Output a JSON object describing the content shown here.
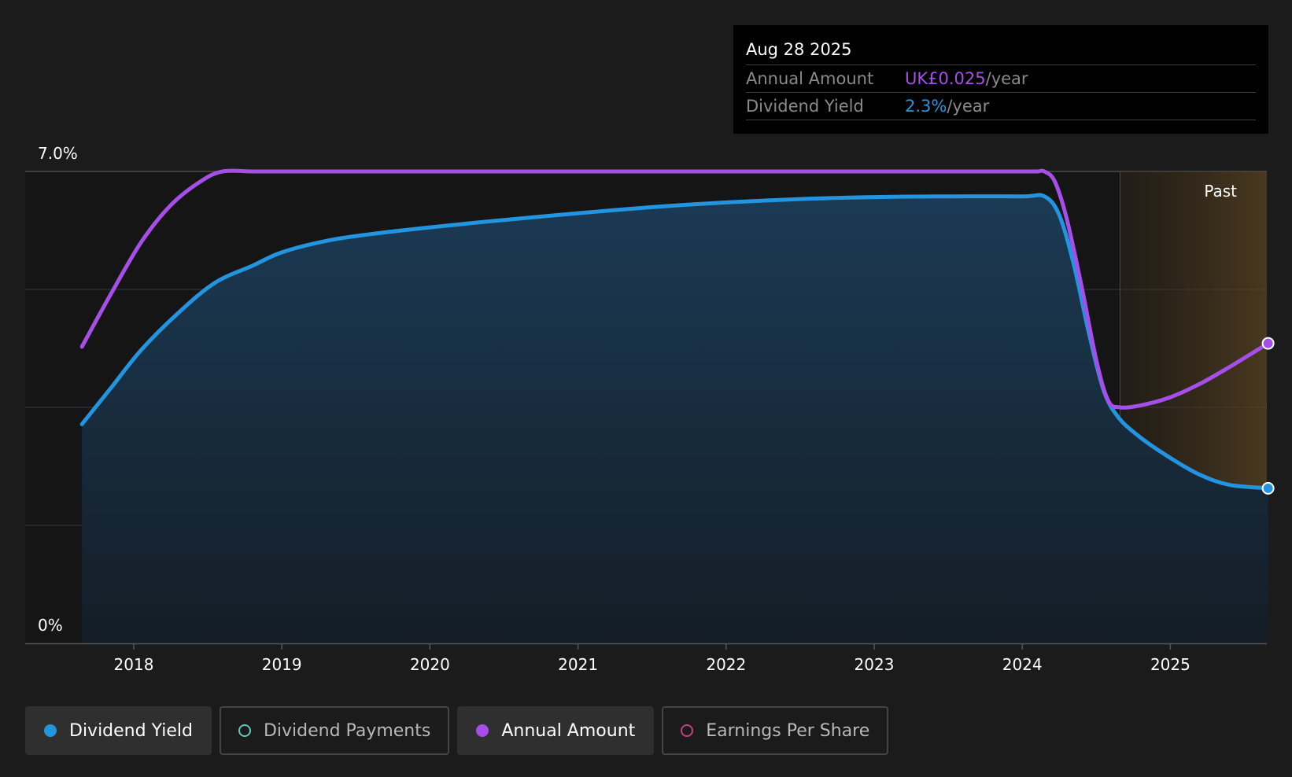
{
  "tooltip": {
    "date": "Aug 28 2025",
    "rows": [
      {
        "label": "Annual Amount",
        "value": "UK£0.025",
        "unit": "/year",
        "color": "#a64ee8"
      },
      {
        "label": "Dividend Yield",
        "value": "2.3%",
        "unit": "/year",
        "color": "#2394df"
      }
    ]
  },
  "legend": [
    {
      "label": "Dividend Yield",
      "color": "#2394df",
      "filled": true,
      "active": true
    },
    {
      "label": "Dividend Payments",
      "color": "#5ec9b4",
      "filled": false,
      "active": false
    },
    {
      "label": "Annual Amount",
      "color": "#a64ee8",
      "filled": true,
      "active": true
    },
    {
      "label": "Earnings Per Share",
      "color": "#c0437d",
      "filled": false,
      "active": false
    }
  ],
  "chart_data": {
    "type": "line",
    "y_axis_labels": [
      "7.0%",
      "0%"
    ],
    "ylim": [
      0,
      7.0
    ],
    "xlim": [
      2017.65,
      2025.66
    ],
    "x_ticks": [
      "2018",
      "2019",
      "2020",
      "2021",
      "2022",
      "2023",
      "2024",
      "2025"
    ],
    "past_label": "Past",
    "past_start": 2024.66,
    "grid": true,
    "series": [
      {
        "name": "Dividend Yield",
        "color": "#2394df",
        "area": true,
        "x": [
          2017.65,
          2017.85,
          2018.05,
          2018.3,
          2018.55,
          2018.8,
          2019.0,
          2019.3,
          2019.6,
          2020.0,
          2020.5,
          2021.0,
          2021.5,
          2022.0,
          2022.5,
          2023.0,
          2023.5,
          2024.0,
          2024.15,
          2024.25,
          2024.35,
          2024.45,
          2024.55,
          2024.65,
          2024.8,
          2025.0,
          2025.2,
          2025.4,
          2025.66
        ],
        "y": [
          3.25,
          3.8,
          4.35,
          4.9,
          5.35,
          5.6,
          5.8,
          5.97,
          6.07,
          6.17,
          6.28,
          6.38,
          6.47,
          6.54,
          6.59,
          6.62,
          6.63,
          6.63,
          6.63,
          6.35,
          5.6,
          4.6,
          3.75,
          3.35,
          3.05,
          2.75,
          2.5,
          2.35,
          2.3
        ]
      },
      {
        "name": "Annual Amount",
        "color": "#a64ee8",
        "area": false,
        "x": [
          2017.65,
          2017.85,
          2018.05,
          2018.25,
          2018.45,
          2018.6,
          2018.8,
          2019.0,
          2020.0,
          2021.0,
          2022.0,
          2023.0,
          2024.0,
          2024.1,
          2024.15,
          2024.22,
          2024.3,
          2024.4,
          2024.5,
          2024.58,
          2024.66,
          2024.8,
          2025.0,
          2025.2,
          2025.4,
          2025.66
        ],
        "y": [
          4.4,
          5.2,
          5.95,
          6.5,
          6.85,
          7.0,
          7.0,
          7.0,
          7.0,
          7.0,
          7.0,
          7.0,
          7.0,
          7.0,
          7.0,
          6.85,
          6.3,
          5.3,
          4.2,
          3.6,
          3.5,
          3.53,
          3.65,
          3.85,
          4.1,
          4.45
        ]
      }
    ]
  }
}
